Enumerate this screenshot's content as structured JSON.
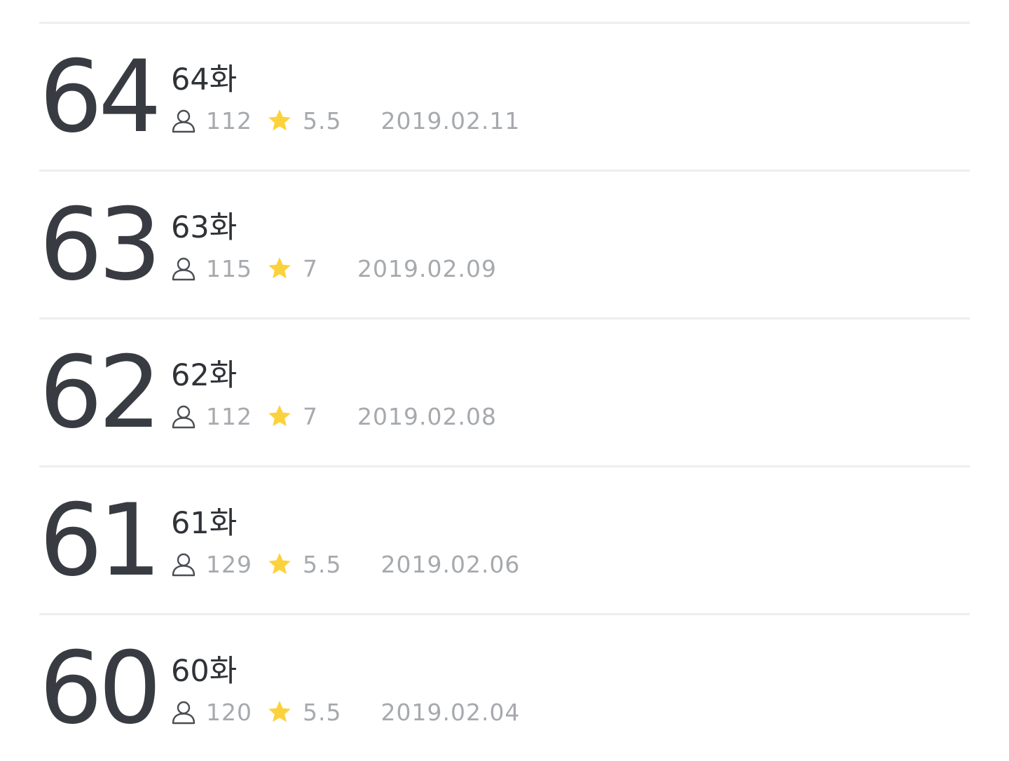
{
  "episodes": [
    {
      "number": "64",
      "title": "64화",
      "views": "112",
      "rating": "5.5",
      "date": "2019.02.11"
    },
    {
      "number": "63",
      "title": "63화",
      "views": "115",
      "rating": "7",
      "date": "2019.02.09"
    },
    {
      "number": "62",
      "title": "62화",
      "views": "112",
      "rating": "7",
      "date": "2019.02.08"
    },
    {
      "number": "61",
      "title": "61화",
      "views": "129",
      "rating": "5.5",
      "date": "2019.02.06"
    },
    {
      "number": "60",
      "title": "60화",
      "views": "120",
      "rating": "5.5",
      "date": "2019.02.04"
    }
  ],
  "icons": {
    "views": "user-icon",
    "rating": "star-icon"
  },
  "colors": {
    "number": "#383c42",
    "title": "#2f3338",
    "meta": "#a6a9ad",
    "star": "#fcd23c",
    "divider": "#eeeeee"
  }
}
